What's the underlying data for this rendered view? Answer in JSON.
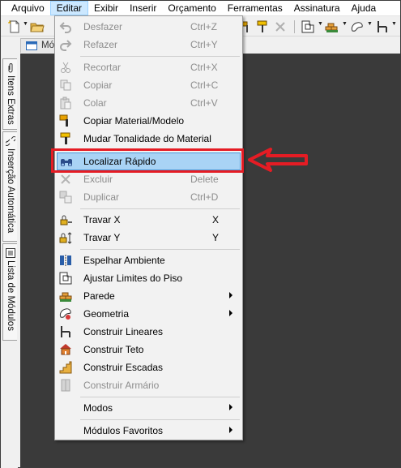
{
  "menubar": {
    "items": [
      "Arquivo",
      "Editar",
      "Exibir",
      "Inserir",
      "Orçamento",
      "Ferramentas",
      "Assinatura",
      "Ajuda"
    ]
  },
  "doc_tab": {
    "label": "Mó"
  },
  "sidebar": {
    "tabs": [
      "Itens Extras",
      "Inserção Automática",
      "Lista de Módulos"
    ]
  },
  "edit_menu": {
    "items": [
      {
        "label": "Desfazer",
        "shortcut": "Ctrl+Z",
        "enabled": false,
        "icon": "undo-icon"
      },
      {
        "label": "Refazer",
        "shortcut": "Ctrl+Y",
        "enabled": false,
        "icon": "redo-icon"
      },
      {
        "label": "Recortar",
        "shortcut": "Ctrl+X",
        "enabled": false,
        "icon": "cut-icon"
      },
      {
        "label": "Copiar",
        "shortcut": "Ctrl+C",
        "enabled": false,
        "icon": "copy-icon"
      },
      {
        "label": "Colar",
        "shortcut": "Ctrl+V",
        "enabled": false,
        "icon": "paste-icon"
      },
      {
        "label": "Copiar Material/Modelo",
        "shortcut": "",
        "enabled": true,
        "icon": "paint-brush-icon"
      },
      {
        "label": "Mudar Tonalidade do Material",
        "shortcut": "",
        "enabled": true,
        "icon": "paint-roller-icon"
      },
      {
        "label": "Localizar Rápido",
        "shortcut": "",
        "enabled": true,
        "highlighted": true,
        "icon": "binoculars-icon"
      },
      {
        "label": "Excluir",
        "shortcut": "Delete",
        "enabled": false,
        "icon": "delete-icon"
      },
      {
        "label": "Duplicar",
        "shortcut": "Ctrl+D",
        "enabled": false,
        "icon": "duplicate-icon"
      },
      {
        "label": "Travar X",
        "shortcut": "X",
        "enabled": true,
        "icon": "lock-x-icon"
      },
      {
        "label": "Travar Y",
        "shortcut": "Y",
        "enabled": true,
        "icon": "lock-y-icon"
      },
      {
        "label": "Espelhar Ambiente",
        "shortcut": "",
        "enabled": true,
        "icon": "mirror-icon"
      },
      {
        "label": "Ajustar Limites do Piso",
        "shortcut": "",
        "enabled": true,
        "icon": "floor-limits-icon"
      },
      {
        "label": "Parede",
        "shortcut": "",
        "enabled": true,
        "submenu": true,
        "icon": "wall-icon"
      },
      {
        "label": "Geometria",
        "shortcut": "",
        "enabled": true,
        "submenu": true,
        "icon": "geometry-icon"
      },
      {
        "label": "Construir Lineares",
        "shortcut": "",
        "enabled": true,
        "icon": "linear-icon"
      },
      {
        "label": "Construir Teto",
        "shortcut": "",
        "enabled": true,
        "icon": "ceiling-icon"
      },
      {
        "label": "Construir Escadas",
        "shortcut": "",
        "enabled": true,
        "icon": "stairs-icon"
      },
      {
        "label": "Construir Armário",
        "shortcut": "",
        "enabled": false,
        "icon": "cabinet-icon"
      },
      {
        "label": "Modos",
        "shortcut": "",
        "enabled": true,
        "submenu": true,
        "icon": ""
      },
      {
        "label": "Módulos Favoritos",
        "shortcut": "",
        "enabled": true,
        "submenu": true,
        "icon": ""
      }
    ]
  },
  "colors": {
    "highlight_bg": "#a9d3f5",
    "highlight_border": "#4a98d8",
    "annotation_red": "#e51c24",
    "canvas_bg": "#3a3a3a",
    "disabled_text": "#8d8d8d"
  }
}
